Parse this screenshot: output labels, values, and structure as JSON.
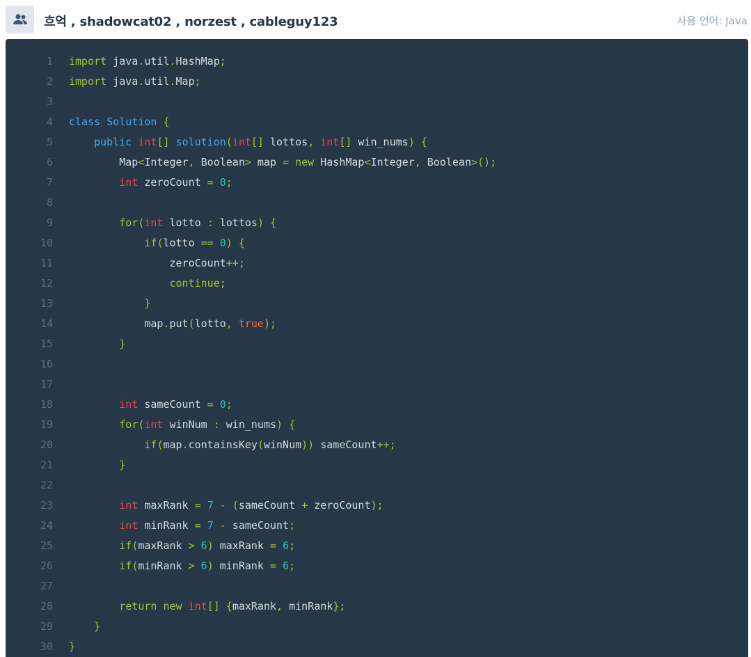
{
  "header": {
    "authors": "흐억 , shadowcat02 , norzest , cableguy123",
    "language_label": "사용 언어: Java"
  },
  "code": {
    "lines": [
      [
        [
          "kw",
          "import"
        ],
        [
          "id",
          " java"
        ],
        [
          "pu",
          "."
        ],
        [
          "id",
          "util"
        ],
        [
          "pu",
          "."
        ],
        [
          "id",
          "HashMap"
        ],
        [
          "pu",
          ";"
        ]
      ],
      [
        [
          "kw",
          "import"
        ],
        [
          "id",
          " java"
        ],
        [
          "pu",
          "."
        ],
        [
          "id",
          "util"
        ],
        [
          "pu",
          "."
        ],
        [
          "id",
          "Map"
        ],
        [
          "pu",
          ";"
        ]
      ],
      [],
      [
        [
          "kb",
          "class"
        ],
        [
          "id",
          " "
        ],
        [
          "fn",
          "Solution"
        ],
        [
          "id",
          " "
        ],
        [
          "pu",
          "{"
        ]
      ],
      [
        [
          "id",
          "    "
        ],
        [
          "kb",
          "public"
        ],
        [
          "id",
          " "
        ],
        [
          "ty",
          "int"
        ],
        [
          "pu",
          "[]"
        ],
        [
          "id",
          " "
        ],
        [
          "fn",
          "solution"
        ],
        [
          "pu",
          "("
        ],
        [
          "ty",
          "int"
        ],
        [
          "pu",
          "[]"
        ],
        [
          "id",
          " lottos"
        ],
        [
          "pu",
          ","
        ],
        [
          "id",
          " "
        ],
        [
          "ty",
          "int"
        ],
        [
          "pu",
          "[]"
        ],
        [
          "id",
          " win_nums"
        ],
        [
          "pu",
          ")"
        ],
        [
          "id",
          " "
        ],
        [
          "pu",
          "{"
        ]
      ],
      [
        [
          "id",
          "        Map"
        ],
        [
          "pu",
          "<"
        ],
        [
          "id",
          "Integer"
        ],
        [
          "pu",
          ","
        ],
        [
          "id",
          " Boolean"
        ],
        [
          "pu",
          ">"
        ],
        [
          "id",
          " map "
        ],
        [
          "pu",
          "="
        ],
        [
          "id",
          " "
        ],
        [
          "kw",
          "new"
        ],
        [
          "id",
          " HashMap"
        ],
        [
          "pu",
          "<"
        ],
        [
          "id",
          "Integer"
        ],
        [
          "pu",
          ","
        ],
        [
          "id",
          " Boolean"
        ],
        [
          "pu",
          ">();"
        ]
      ],
      [
        [
          "id",
          "        "
        ],
        [
          "ty",
          "int"
        ],
        [
          "id",
          " zeroCount "
        ],
        [
          "pu",
          "="
        ],
        [
          "id",
          " "
        ],
        [
          "nu",
          "0"
        ],
        [
          "pu",
          ";"
        ]
      ],
      [],
      [
        [
          "id",
          "        "
        ],
        [
          "kw",
          "for"
        ],
        [
          "pu",
          "("
        ],
        [
          "ty",
          "int"
        ],
        [
          "id",
          " lotto "
        ],
        [
          "pu",
          ":"
        ],
        [
          "id",
          " lottos"
        ],
        [
          "pu",
          ")"
        ],
        [
          "id",
          " "
        ],
        [
          "pu",
          "{"
        ]
      ],
      [
        [
          "id",
          "            "
        ],
        [
          "kw",
          "if"
        ],
        [
          "pu",
          "("
        ],
        [
          "id",
          "lotto "
        ],
        [
          "pu",
          "=="
        ],
        [
          "id",
          " "
        ],
        [
          "nu",
          "0"
        ],
        [
          "pu",
          ")"
        ],
        [
          "id",
          " "
        ],
        [
          "pu",
          "{"
        ]
      ],
      [
        [
          "id",
          "                zeroCount"
        ],
        [
          "pu",
          "++;"
        ]
      ],
      [
        [
          "id",
          "                "
        ],
        [
          "kw",
          "continue"
        ],
        [
          "pu",
          ";"
        ]
      ],
      [
        [
          "id",
          "            "
        ],
        [
          "pu",
          "}"
        ]
      ],
      [
        [
          "id",
          "            map"
        ],
        [
          "pu",
          "."
        ],
        [
          "id",
          "put"
        ],
        [
          "pu",
          "("
        ],
        [
          "id",
          "lotto"
        ],
        [
          "pu",
          ","
        ],
        [
          "id",
          " "
        ],
        [
          "bo",
          "true"
        ],
        [
          "pu",
          ");"
        ]
      ],
      [
        [
          "id",
          "        "
        ],
        [
          "pu",
          "}"
        ]
      ],
      [],
      [],
      [
        [
          "id",
          "        "
        ],
        [
          "ty",
          "int"
        ],
        [
          "id",
          " sameCount "
        ],
        [
          "pu",
          "="
        ],
        [
          "id",
          " "
        ],
        [
          "nu",
          "0"
        ],
        [
          "pu",
          ";"
        ]
      ],
      [
        [
          "id",
          "        "
        ],
        [
          "kw",
          "for"
        ],
        [
          "pu",
          "("
        ],
        [
          "ty",
          "int"
        ],
        [
          "id",
          " winNum "
        ],
        [
          "pu",
          ":"
        ],
        [
          "id",
          " win_nums"
        ],
        [
          "pu",
          ")"
        ],
        [
          "id",
          " "
        ],
        [
          "pu",
          "{"
        ]
      ],
      [
        [
          "id",
          "            "
        ],
        [
          "kw",
          "if"
        ],
        [
          "pu",
          "("
        ],
        [
          "id",
          "map"
        ],
        [
          "pu",
          "."
        ],
        [
          "id",
          "containsKey"
        ],
        [
          "pu",
          "("
        ],
        [
          "id",
          "winNum"
        ],
        [
          "pu",
          "))"
        ],
        [
          "id",
          " sameCount"
        ],
        [
          "pu",
          "++;"
        ]
      ],
      [
        [
          "id",
          "        "
        ],
        [
          "pu",
          "}"
        ]
      ],
      [],
      [
        [
          "id",
          "        "
        ],
        [
          "ty",
          "int"
        ],
        [
          "id",
          " maxRank "
        ],
        [
          "pu",
          "="
        ],
        [
          "id",
          " "
        ],
        [
          "nu",
          "7"
        ],
        [
          "id",
          " "
        ],
        [
          "pu",
          "-"
        ],
        [
          "id",
          " "
        ],
        [
          "pu",
          "("
        ],
        [
          "id",
          "sameCount "
        ],
        [
          "pu",
          "+"
        ],
        [
          "id",
          " zeroCount"
        ],
        [
          "pu",
          ");"
        ]
      ],
      [
        [
          "id",
          "        "
        ],
        [
          "ty",
          "int"
        ],
        [
          "id",
          " minRank "
        ],
        [
          "pu",
          "="
        ],
        [
          "id",
          " "
        ],
        [
          "nu",
          "7"
        ],
        [
          "id",
          " "
        ],
        [
          "pu",
          "-"
        ],
        [
          "id",
          " sameCount"
        ],
        [
          "pu",
          ";"
        ]
      ],
      [
        [
          "id",
          "        "
        ],
        [
          "kw",
          "if"
        ],
        [
          "pu",
          "("
        ],
        [
          "id",
          "maxRank "
        ],
        [
          "pu",
          ">"
        ],
        [
          "id",
          " "
        ],
        [
          "nu",
          "6"
        ],
        [
          "pu",
          ")"
        ],
        [
          "id",
          " maxRank "
        ],
        [
          "pu",
          "="
        ],
        [
          "id",
          " "
        ],
        [
          "nu",
          "6"
        ],
        [
          "pu",
          ";"
        ]
      ],
      [
        [
          "id",
          "        "
        ],
        [
          "kw",
          "if"
        ],
        [
          "pu",
          "("
        ],
        [
          "id",
          "minRank "
        ],
        [
          "pu",
          ">"
        ],
        [
          "id",
          " "
        ],
        [
          "nu",
          "6"
        ],
        [
          "pu",
          ")"
        ],
        [
          "id",
          " minRank "
        ],
        [
          "pu",
          "="
        ],
        [
          "id",
          " "
        ],
        [
          "nu",
          "6"
        ],
        [
          "pu",
          ";"
        ]
      ],
      [],
      [
        [
          "id",
          "        "
        ],
        [
          "kw",
          "return"
        ],
        [
          "id",
          " "
        ],
        [
          "kw",
          "new"
        ],
        [
          "id",
          " "
        ],
        [
          "ty",
          "int"
        ],
        [
          "pu",
          "[]"
        ],
        [
          "id",
          " "
        ],
        [
          "pu",
          "{"
        ],
        [
          "id",
          "maxRank"
        ],
        [
          "pu",
          ","
        ],
        [
          "id",
          " minRank"
        ],
        [
          "pu",
          "};"
        ]
      ],
      [
        [
          "id",
          "    "
        ],
        [
          "pu",
          "}"
        ]
      ],
      [
        [
          "pu",
          "}"
        ]
      ]
    ]
  }
}
